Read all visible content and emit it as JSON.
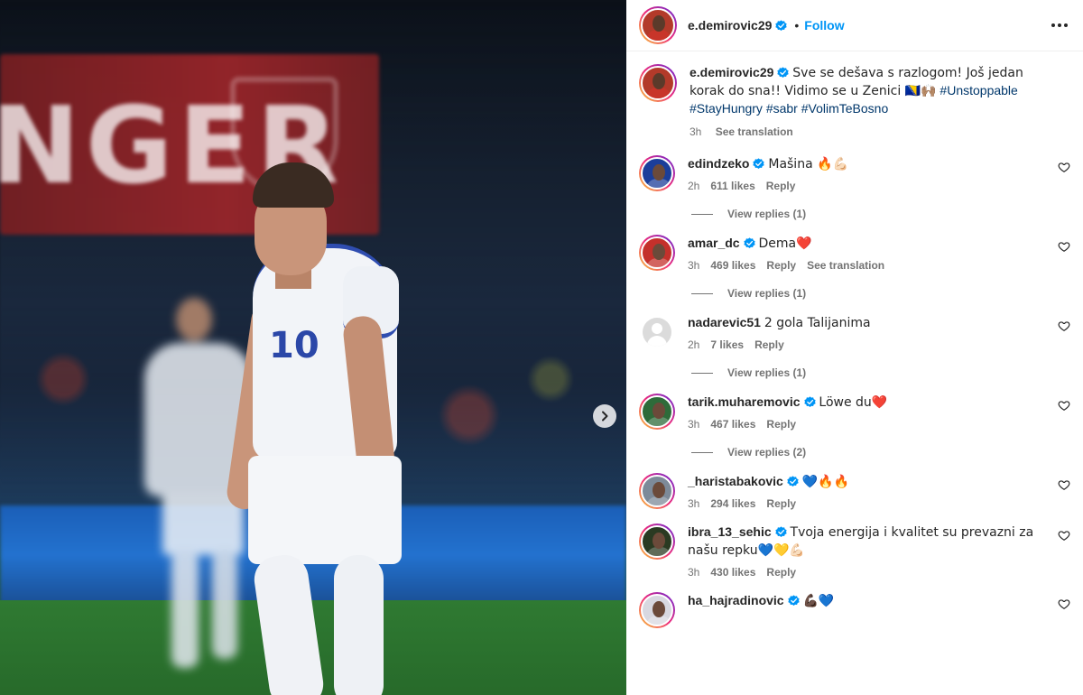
{
  "post": {
    "author": "e.demirovic29",
    "follow_label": "Follow",
    "separator": "•",
    "caption_text": "Sve se dešava s razlogom! Još jedan korak do sna!! Vidimo se u Zenici 🇧🇦🙌🏽",
    "caption_flag": "BA",
    "hashtags": [
      "#Unstoppable",
      "#StayHungry",
      "#sabr",
      "#VolimTeBosno"
    ],
    "caption_time": "3h",
    "see_translation": "See translation"
  },
  "photo": {
    "banner_text": "NGER",
    "jersey_number": "10"
  },
  "comments": [
    {
      "user": "edindzeko",
      "verified": true,
      "text": "Mašina 🔥💪🏻",
      "time": "2h",
      "likes": "611 likes",
      "reply": "Reply",
      "translation": "",
      "view_replies": "View replies (1)",
      "avatar_color": "#1b3e9a"
    },
    {
      "user": "amar_dc",
      "verified": true,
      "text": "Dema❤️",
      "time": "3h",
      "likes": "469 likes",
      "reply": "Reply",
      "translation": "See translation",
      "view_replies": "View replies (1)",
      "avatar_color": "#c4302b"
    },
    {
      "user": "nadarevic51",
      "verified": false,
      "text": "2 gola Talijanima",
      "time": "2h",
      "likes": "7 likes",
      "reply": "Reply",
      "translation": "",
      "view_replies": "View replies (1)",
      "avatar_color": "#dbdbdb"
    },
    {
      "user": "tarik.muharemovic",
      "verified": true,
      "text": "Löwe du❤️",
      "time": "3h",
      "likes": "467 likes",
      "reply": "Reply",
      "translation": "",
      "view_replies": "View replies (2)",
      "avatar_color": "#2e6b3a"
    },
    {
      "user": "_haristabakovic",
      "verified": true,
      "text": "💙🔥🔥",
      "time": "3h",
      "likes": "294 likes",
      "reply": "Reply",
      "translation": "",
      "view_replies": "",
      "avatar_color": "#7d8a99"
    },
    {
      "user": "ibra_13_sehic",
      "verified": true,
      "text": "Tvoja energija i kvalitet su prevazni za našu repku💙💛💪🏻",
      "time": "3h",
      "likes": "430 likes",
      "reply": "Reply",
      "translation": "",
      "view_replies": "",
      "avatar_color": "#2a3a22"
    },
    {
      "user": "ha_hajradinovic",
      "verified": true,
      "text": "💪🏿💙",
      "time": "",
      "likes": "",
      "reply": "",
      "translation": "",
      "view_replies": "",
      "avatar_color": "#d8d8e0"
    }
  ],
  "icons": {
    "verified": "verified-badge-icon",
    "more": "more-horizontal-icon",
    "heart": "heart-outline-icon",
    "next": "chevron-right-icon"
  },
  "colors": {
    "accent": "#0095f6",
    "hashtag": "#00376b",
    "muted": "#737373",
    "verified": "#0095f6"
  }
}
